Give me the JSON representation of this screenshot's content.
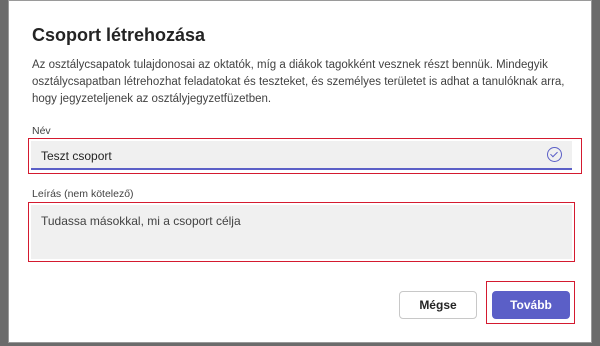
{
  "dialog": {
    "title": "Csoport létrehozása",
    "description": "Az osztálycsapatok tulajdonosai az oktatók, míg a diákok tagokként vesznek részt bennük. Mindegyik osztálycsapatban létrehozhat feladatokat és teszteket, és személyes területet is adhat a tanulóknak arra, hogy jegyzeteljenek az osztályjegyzetfüzetben."
  },
  "name_field": {
    "label": "Név",
    "value": "Teszt csoport",
    "status_icon": "check-circle-icon"
  },
  "description_field": {
    "label": "Leírás (nem kötelező)",
    "placeholder": "Tudassa másokkal, mi a csoport célja"
  },
  "buttons": {
    "cancel": "Mégse",
    "next": "Tovább"
  },
  "colors": {
    "accent": "#5b5fc7",
    "highlight": "#d41a2f"
  }
}
